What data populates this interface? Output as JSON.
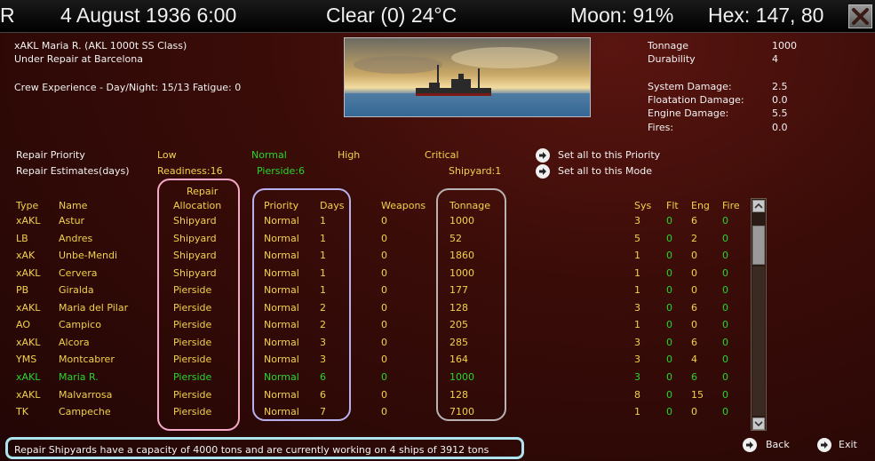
{
  "header": {
    "left_initial": "R",
    "date": "4 August 1936 6:00",
    "weather": "Clear (0) 24°C",
    "moon": "Moon: 91%",
    "hex": "Hex: 147, 80"
  },
  "ship": {
    "name_class": "xAKL Maria R. (AKL 1000t SS Class)",
    "status": "Under Repair at Barcelona",
    "crew": "Crew Experience - Day/Night: 15/13 Fatigue: 0"
  },
  "stats": [
    {
      "label": "Tonnage",
      "value": "1000"
    },
    {
      "label": "Durability",
      "value": "4"
    },
    {
      "label": "System Damage:",
      "value": "2.5"
    },
    {
      "label": "Floatation Damage:",
      "value": "0.0"
    },
    {
      "label": "Engine Damage:",
      "value": "5.5"
    },
    {
      "label": "Fires:",
      "value": "0.0"
    }
  ],
  "priority_bar": {
    "label": "Repair Priority",
    "low": "Low",
    "normal": "Normal",
    "high": "High",
    "critical": "Critical",
    "set_priority": "Set all to this Priority"
  },
  "estimates_bar": {
    "label": "Repair Estimates(days)",
    "readiness": "Readiness:16",
    "pierside": "Pierside:6",
    "shipyard": "Shipyard:1",
    "set_mode": "Set all to this Mode"
  },
  "columns": {
    "type": "Type",
    "name": "Name",
    "repair": "Repair",
    "allocation": "Allocation",
    "priority": "Priority",
    "days": "Days",
    "weapons": "Weapons",
    "tonnage": "Tonnage",
    "sys": "Sys",
    "flt": "Flt",
    "eng": "Eng",
    "fire": "Fire"
  },
  "rows": [
    {
      "type": "xAKL",
      "name": "Astur",
      "allocation": "Shipyard",
      "priority": "Normal",
      "days": "1",
      "weapons": "0",
      "tonnage": "1000",
      "sys": "3",
      "flt": "0",
      "eng": "6",
      "fire": "0",
      "selected": false
    },
    {
      "type": "LB",
      "name": "Andres",
      "allocation": "Shipyard",
      "priority": "Normal",
      "days": "1",
      "weapons": "0",
      "tonnage": "52",
      "sys": "5",
      "flt": "0",
      "eng": "2",
      "fire": "0",
      "selected": false
    },
    {
      "type": "xAK",
      "name": "Unbe-Mendi",
      "allocation": "Shipyard",
      "priority": "Normal",
      "days": "1",
      "weapons": "0",
      "tonnage": "1860",
      "sys": "1",
      "flt": "0",
      "eng": "0",
      "fire": "0",
      "selected": false
    },
    {
      "type": "xAKL",
      "name": "Cervera",
      "allocation": "Shipyard",
      "priority": "Normal",
      "days": "1",
      "weapons": "0",
      "tonnage": "1000",
      "sys": "1",
      "flt": "0",
      "eng": "0",
      "fire": "0",
      "selected": false
    },
    {
      "type": "PB",
      "name": "Giralda",
      "allocation": "Pierside",
      "priority": "Normal",
      "days": "1",
      "weapons": "0",
      "tonnage": "177",
      "sys": "1",
      "flt": "0",
      "eng": "0",
      "fire": "0",
      "selected": false
    },
    {
      "type": "xAKL",
      "name": "Maria del Pilar",
      "allocation": "Pierside",
      "priority": "Normal",
      "days": "2",
      "weapons": "0",
      "tonnage": "128",
      "sys": "3",
      "flt": "0",
      "eng": "6",
      "fire": "0",
      "selected": false
    },
    {
      "type": "AO",
      "name": "Campico",
      "allocation": "Pierside",
      "priority": "Normal",
      "days": "2",
      "weapons": "0",
      "tonnage": "205",
      "sys": "1",
      "flt": "0",
      "eng": "0",
      "fire": "0",
      "selected": false
    },
    {
      "type": "xAKL",
      "name": "Alcora",
      "allocation": "Pierside",
      "priority": "Normal",
      "days": "3",
      "weapons": "0",
      "tonnage": "285",
      "sys": "3",
      "flt": "0",
      "eng": "6",
      "fire": "0",
      "selected": false
    },
    {
      "type": "YMS",
      "name": "Montcabrer",
      "allocation": "Pierside",
      "priority": "Normal",
      "days": "3",
      "weapons": "0",
      "tonnage": "164",
      "sys": "3",
      "flt": "0",
      "eng": "4",
      "fire": "0",
      "selected": false
    },
    {
      "type": "xAKL",
      "name": "Maria R.",
      "allocation": "Pierside",
      "priority": "Normal",
      "days": "6",
      "weapons": "0",
      "tonnage": "1000",
      "sys": "3",
      "flt": "0",
      "eng": "6",
      "fire": "0",
      "selected": true
    },
    {
      "type": "xAKL",
      "name": "Malvarrosa",
      "allocation": "Pierside",
      "priority": "Normal",
      "days": "6",
      "weapons": "0",
      "tonnage": "128",
      "sys": "8",
      "flt": "0",
      "eng": "15",
      "fire": "0",
      "selected": false
    },
    {
      "type": "TK",
      "name": "Campeche",
      "allocation": "Pierside",
      "priority": "Normal",
      "days": "7",
      "weapons": "0",
      "tonnage": "7100",
      "sys": "1",
      "flt": "0",
      "eng": "0",
      "fire": "0",
      "selected": false
    }
  ],
  "footer": {
    "message": "Repair Shipyards have a capacity of 4000 tons and are currently working on 4 ships of 3912 tons",
    "back": "Back",
    "exit": "Exit"
  },
  "colors": {
    "yellow": "#f2d24a",
    "green": "#29d629",
    "highlight_pink": "#f6a9c8",
    "highlight_lavender": "#b9b0ee",
    "highlight_grey": "#b8b2b2",
    "highlight_cyan": "#aee3f0"
  },
  "icons": [
    "close-icon",
    "arrow-right-icon",
    "chevron-up-icon",
    "chevron-down-icon"
  ]
}
